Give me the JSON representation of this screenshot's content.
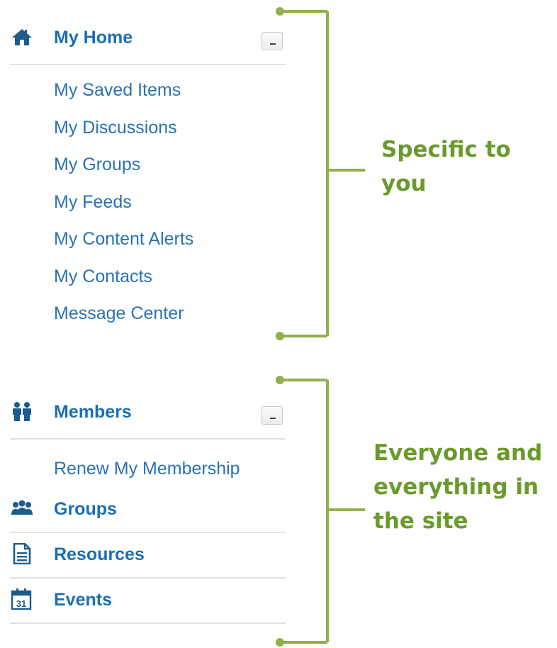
{
  "nav": {
    "home": {
      "label": "My Home",
      "icon": "home-icon",
      "items": [
        {
          "label": "My Saved Items"
        },
        {
          "label": "My Discussions"
        },
        {
          "label": "My Groups"
        },
        {
          "label": "My Feeds"
        },
        {
          "label": "My Content Alerts"
        },
        {
          "label": "My Contacts"
        },
        {
          "label": "Message Center"
        }
      ]
    },
    "members": {
      "label": "Members",
      "icon": "members-icon",
      "items": [
        {
          "label": "Renew My Membership"
        }
      ]
    },
    "groups": {
      "label": "Groups",
      "icon": "groups-icon"
    },
    "resources": {
      "label": "Resources",
      "icon": "document-icon"
    },
    "events": {
      "label": "Events",
      "icon": "calendar-icon",
      "icon_day": "31"
    }
  },
  "annotations": {
    "personal": {
      "lines": [
        "Specific to",
        "you"
      ]
    },
    "site": {
      "lines": [
        "Everyone and",
        "everything in",
        "the site"
      ]
    }
  },
  "colors": {
    "link": "#2a72b5",
    "header": "#1a6fb3",
    "icon": "#1b5b8e",
    "annotation": "#6a9a2b",
    "bracket": "#8fb04b"
  }
}
